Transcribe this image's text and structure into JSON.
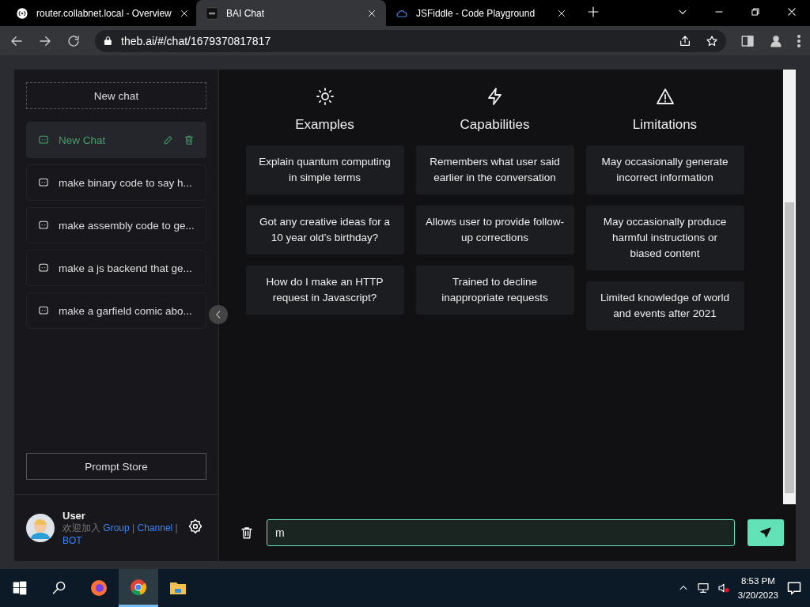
{
  "browser": {
    "tabs": [
      {
        "title": "router.collabnet.local - Overview",
        "kind": "router",
        "selected": false
      },
      {
        "title": "BAI Chat",
        "kind": "bai",
        "selected": true
      },
      {
        "title": "JSFiddle - Code Playground",
        "kind": "cloud",
        "selected": false
      }
    ],
    "address": "theb.ai/#/chat/1679370817817"
  },
  "sidebar": {
    "new_chat": "New chat",
    "chats": [
      {
        "title": "New Chat",
        "selected": true
      },
      {
        "title": "make binary code to say h...",
        "selected": false
      },
      {
        "title": "make assembly code to ge...",
        "selected": false
      },
      {
        "title": "make a js backend that ge...",
        "selected": false
      },
      {
        "title": "make a garfield comic abo...",
        "selected": false
      }
    ],
    "prompt_store": "Prompt Store",
    "user": {
      "name": "User",
      "welcome": [
        {
          "kind": "text",
          "text": "欢迎加入"
        },
        {
          "kind": "link",
          "text": "Group"
        },
        {
          "kind": "text",
          "text": "|"
        },
        {
          "kind": "link",
          "text": "Channel"
        },
        {
          "kind": "text",
          "text": "|"
        },
        {
          "kind": "link",
          "text": "BOT"
        }
      ]
    }
  },
  "main": {
    "columns": [
      {
        "title": "Examples",
        "kind": "sun",
        "items": [
          "Explain quantum computing in simple terms",
          "Got any creative ideas for a 10 year old’s birthday?",
          "How do I make an HTTP request in Javascript?"
        ]
      },
      {
        "title": "Capabilities",
        "kind": "bolt",
        "items": [
          "Remembers what user said earlier in the conversation",
          "Allows user to provide follow-up corrections",
          "Trained to decline inappropriate requests"
        ]
      },
      {
        "title": "Limitations",
        "kind": "warning",
        "items": [
          "May occasionally generate incorrect information",
          "May occasionally produce harmful instructions or biased content",
          "Limited knowledge of world and events after 2021"
        ]
      }
    ],
    "input": {
      "value": "m"
    }
  },
  "taskbar": {
    "apps": [
      {
        "kind": "start",
        "selected": false
      },
      {
        "kind": "search",
        "selected": false
      },
      {
        "kind": "firefox",
        "selected": false
      },
      {
        "kind": "chrome",
        "selected": true
      },
      {
        "kind": "files",
        "selected": false
      }
    ],
    "time": "8:53 PM",
    "date": "3/20/2023"
  }
}
